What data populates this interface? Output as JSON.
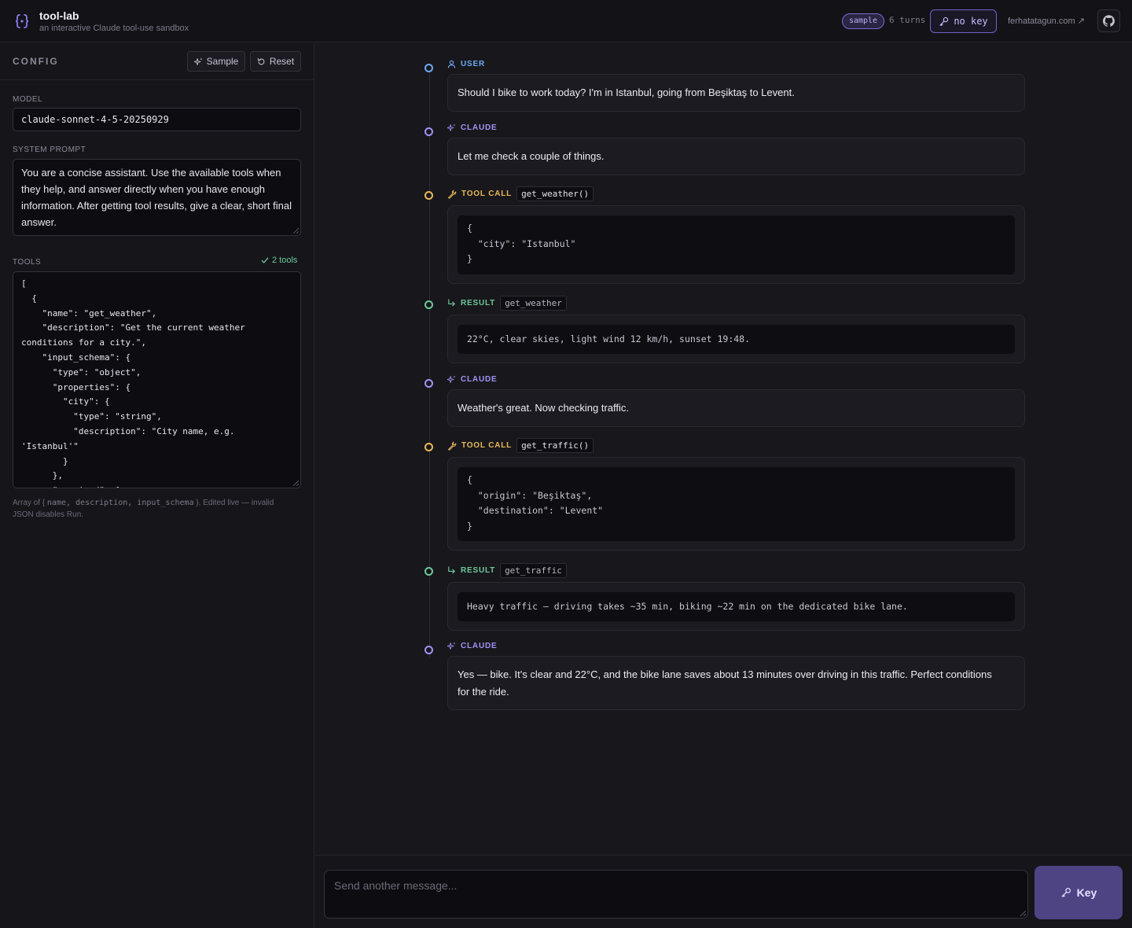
{
  "header": {
    "app_title": "tool-lab",
    "app_subtitle": "an interactive Claude tool-use sandbox",
    "sample_badge": "sample",
    "turns": "6 turns",
    "no_key_label": "no key",
    "site_link": "ferhatatagun.com ↗",
    "icons": [
      "braces-logo-icon",
      "key-icon",
      "github-icon"
    ]
  },
  "sidebar": {
    "title": "CONFIG",
    "sample_button": "Sample",
    "reset_button": "Reset",
    "model_label": "MODEL",
    "model_value": "claude-sonnet-4-5-20250929",
    "system_prompt_label": "SYSTEM PROMPT",
    "system_prompt": "You are a concise assistant. Use the available tools when they help, and answer directly when you have enough information. After getting tool results, give a clear, short final answer.",
    "tools_label": "TOOLS",
    "tools_status": "2 tools",
    "tools_json": "[\n  {\n    \"name\": \"get_weather\",\n    \"description\": \"Get the current weather conditions for a city.\",\n    \"input_schema\": {\n      \"type\": \"object\",\n      \"properties\": {\n        \"city\": {\n          \"type\": \"string\",\n          \"description\": \"City name, e.g. 'Istanbul'\"\n        }\n      },\n      \"required\": [",
    "hint_pre": "Array of { ",
    "hint_code": "name, description, input_schema",
    "hint_post": " }. Edited live — invalid JSON disables Run."
  },
  "timeline": {
    "user_label": "USER",
    "claude_label": "CLAUDE",
    "tool_call_label": "TOOL CALL",
    "result_label": "RESULT",
    "user_msg": "Should I bike to work today? I'm in Istanbul, going from Beşiktaş to Levent.",
    "claude_msg_1": "Let me check a couple of things.",
    "tool_call_1_fn": "get_weather()",
    "tool_call_1_args": "{\n  \"city\": \"Istanbul\"\n}",
    "result_1_fn": "get_weather",
    "result_1_text": "22°C, clear skies, light wind 12 km/h, sunset 19:48.",
    "claude_msg_2": "Weather's great. Now checking traffic.",
    "tool_call_2_fn": "get_traffic()",
    "tool_call_2_args": "{\n  \"origin\": \"Beşiktaş\",\n  \"destination\": \"Levent\"\n}",
    "result_2_fn": "get_traffic",
    "result_2_text": "Heavy traffic — driving takes ~35 min, biking ~22 min on the dedicated bike lane.",
    "claude_msg_3": "Yes — bike. It's clear and 22°C, and the bike lane saves about 13 minutes over driving in this traffic. Perfect conditions for the ride."
  },
  "composer": {
    "placeholder": "Send another message...",
    "key_button": "Key"
  },
  "colors": {
    "accent": "#8b7cf0",
    "user": "#6aa8f0",
    "claude": "#a193f5",
    "tool_call": "#e8b85a",
    "result": "#6dc99a"
  }
}
